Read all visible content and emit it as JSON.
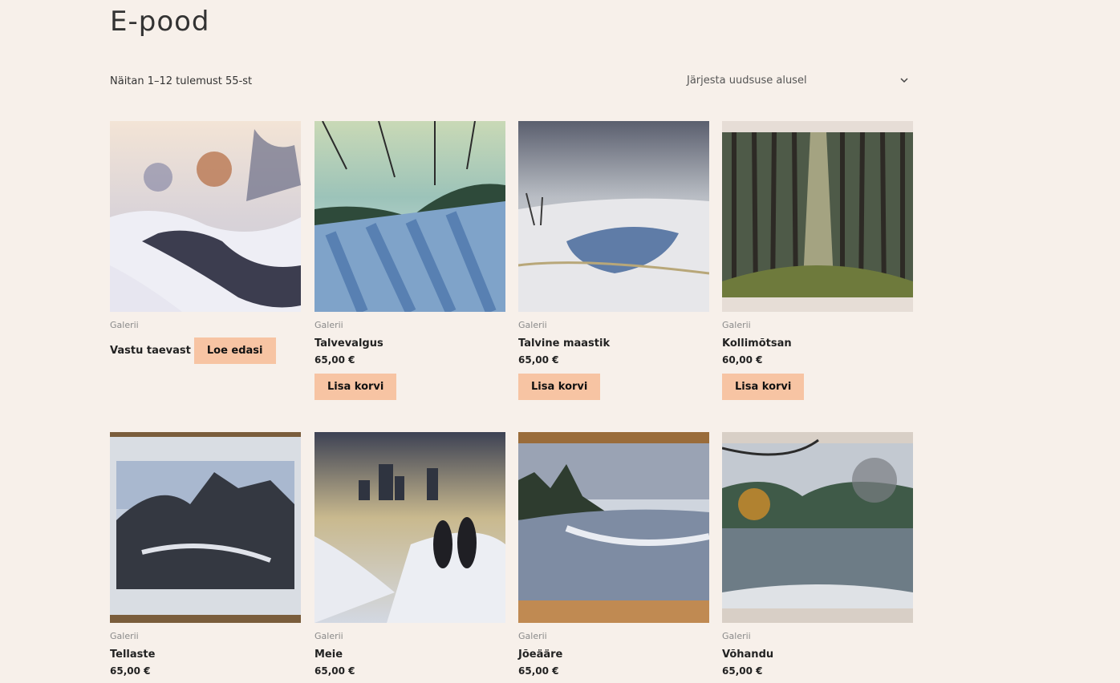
{
  "page": {
    "title": "E-pood",
    "result_count": "Näitan 1–12 tulemust 55-st",
    "sort_label": "Järjesta uudsuse alusel"
  },
  "icons": {
    "sort": "chevron-down-icon"
  },
  "colors": {
    "background": "#f7f0ea",
    "button": "#f7c4a3"
  },
  "products": [
    {
      "category": "Galerii",
      "title": "Vastu taevast",
      "price": "",
      "button": "Loe edasi"
    },
    {
      "category": "Galerii",
      "title": "Talvevalgus",
      "price": "65,00 €",
      "button": "Lisa korvi"
    },
    {
      "category": "Galerii",
      "title": "Talvine maastik",
      "price": "65,00 €",
      "button": "Lisa korvi"
    },
    {
      "category": "Galerii",
      "title": "Kollimõtsan",
      "price": "60,00 €",
      "button": "Lisa korvi"
    },
    {
      "category": "Galerii",
      "title": "Tellaste",
      "price": "65,00 €",
      "button": ""
    },
    {
      "category": "Galerii",
      "title": "Meie",
      "price": "65,00 €",
      "button": ""
    },
    {
      "category": "Galerii",
      "title": "Jõeääre",
      "price": "65,00 €",
      "button": ""
    },
    {
      "category": "Galerii",
      "title": "Võhandu",
      "price": "65,00 €",
      "button": ""
    }
  ]
}
